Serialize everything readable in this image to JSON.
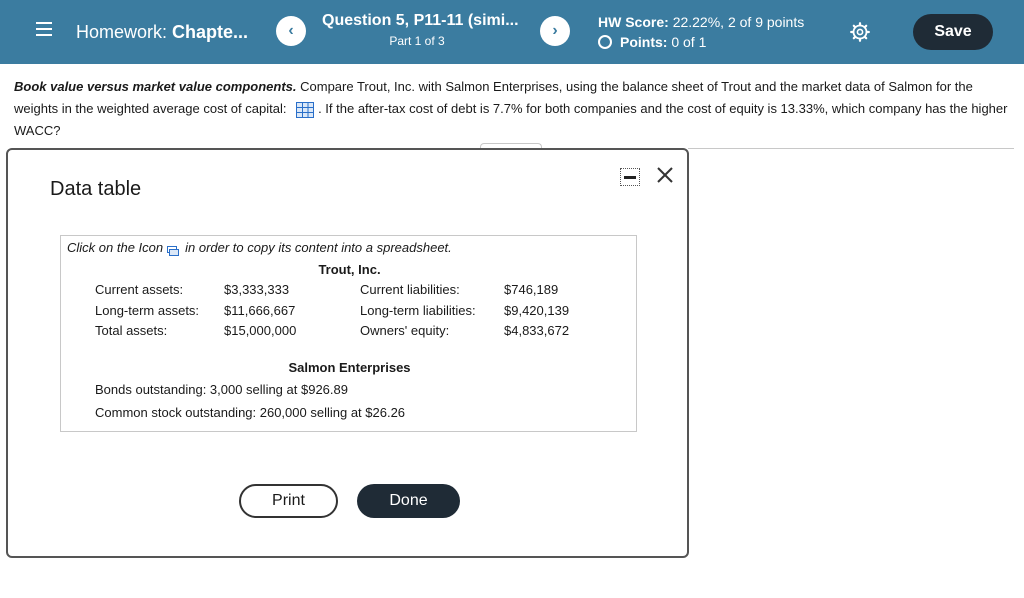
{
  "header": {
    "hw_prefix": "Homework:",
    "hw_title": "Chapte...",
    "question_title": "Question 5, P11-11 (simi...",
    "question_part": "Part 1 of 3",
    "hw_score_label": "HW Score:",
    "hw_score_value": "22.22%, 2 of 9 points",
    "points_label": "Points:",
    "points_value": "0 of 1",
    "prev_glyph": "‹",
    "next_glyph": "›",
    "save_label": "Save"
  },
  "question": {
    "lead": "Book value versus market value components.",
    "text_1": "Compare Trout, Inc. with Salmon Enterprises, using the balance sheet of Trout and the market data of Salmon for the weights in the weighted average cost of capital:",
    "text_2": ". If the after-tax cost of debt is 7.7% for both companies and the cost of equity is 13.33%, which company has the higher WACC?"
  },
  "modal": {
    "title": "Data table",
    "copy_note_prefix": "Click on the Icon",
    "copy_note_suffix": "in order to copy its content into a spreadsheet.",
    "trout_title": "Trout, Inc.",
    "trout_rows": [
      {
        "label_left": "Current assets:",
        "value_left": "$3,333,333",
        "label_right": "Current liabilities:",
        "value_right": "$746,189"
      },
      {
        "label_left": "Long-term assets:",
        "value_left": "$11,666,667",
        "label_right": "Long-term liabilities:",
        "value_right": "$9,420,139"
      },
      {
        "label_left": "Total assets:",
        "value_left": "$15,000,000",
        "label_right": "Owners' equity:",
        "value_right": "$4,833,672"
      }
    ],
    "salmon_title": "Salmon Enterprises",
    "salmon_lines": [
      "Bonds outstanding:  3,000 selling at $926.89",
      "Common stock outstanding:  260,000 selling at $26.26"
    ],
    "print_label": "Print",
    "done_label": "Done"
  },
  "colors": {
    "header_bg": "#3b7ca0",
    "dark_button": "#1f2b36",
    "grid_icon": "#2a6fc9"
  },
  "icons": [
    "menu-icon",
    "chevron-left-icon",
    "chevron-right-icon",
    "radio-circle-icon",
    "gear-icon",
    "table-grid-icon",
    "minimize-icon",
    "close-icon",
    "copy-icon"
  ]
}
